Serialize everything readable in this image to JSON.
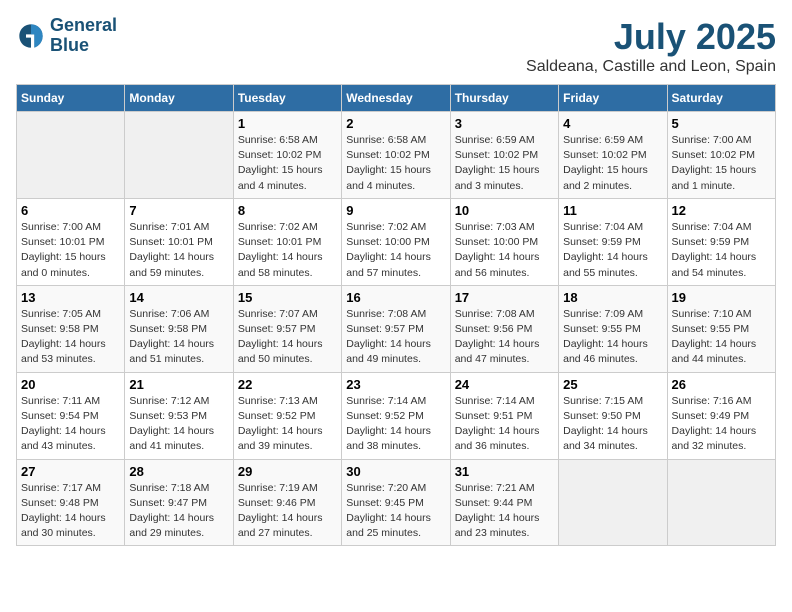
{
  "header": {
    "logo_line1": "General",
    "logo_line2": "Blue",
    "month_title": "July 2025",
    "location": "Saldeana, Castille and Leon, Spain"
  },
  "weekdays": [
    "Sunday",
    "Monday",
    "Tuesday",
    "Wednesday",
    "Thursday",
    "Friday",
    "Saturday"
  ],
  "weeks": [
    [
      {
        "day": "",
        "sunrise": "",
        "sunset": "",
        "daylight": ""
      },
      {
        "day": "",
        "sunrise": "",
        "sunset": "",
        "daylight": ""
      },
      {
        "day": "1",
        "sunrise": "Sunrise: 6:58 AM",
        "sunset": "Sunset: 10:02 PM",
        "daylight": "Daylight: 15 hours and 4 minutes."
      },
      {
        "day": "2",
        "sunrise": "Sunrise: 6:58 AM",
        "sunset": "Sunset: 10:02 PM",
        "daylight": "Daylight: 15 hours and 4 minutes."
      },
      {
        "day": "3",
        "sunrise": "Sunrise: 6:59 AM",
        "sunset": "Sunset: 10:02 PM",
        "daylight": "Daylight: 15 hours and 3 minutes."
      },
      {
        "day": "4",
        "sunrise": "Sunrise: 6:59 AM",
        "sunset": "Sunset: 10:02 PM",
        "daylight": "Daylight: 15 hours and 2 minutes."
      },
      {
        "day": "5",
        "sunrise": "Sunrise: 7:00 AM",
        "sunset": "Sunset: 10:02 PM",
        "daylight": "Daylight: 15 hours and 1 minute."
      }
    ],
    [
      {
        "day": "6",
        "sunrise": "Sunrise: 7:00 AM",
        "sunset": "Sunset: 10:01 PM",
        "daylight": "Daylight: 15 hours and 0 minutes."
      },
      {
        "day": "7",
        "sunrise": "Sunrise: 7:01 AM",
        "sunset": "Sunset: 10:01 PM",
        "daylight": "Daylight: 14 hours and 59 minutes."
      },
      {
        "day": "8",
        "sunrise": "Sunrise: 7:02 AM",
        "sunset": "Sunset: 10:01 PM",
        "daylight": "Daylight: 14 hours and 58 minutes."
      },
      {
        "day": "9",
        "sunrise": "Sunrise: 7:02 AM",
        "sunset": "Sunset: 10:00 PM",
        "daylight": "Daylight: 14 hours and 57 minutes."
      },
      {
        "day": "10",
        "sunrise": "Sunrise: 7:03 AM",
        "sunset": "Sunset: 10:00 PM",
        "daylight": "Daylight: 14 hours and 56 minutes."
      },
      {
        "day": "11",
        "sunrise": "Sunrise: 7:04 AM",
        "sunset": "Sunset: 9:59 PM",
        "daylight": "Daylight: 14 hours and 55 minutes."
      },
      {
        "day": "12",
        "sunrise": "Sunrise: 7:04 AM",
        "sunset": "Sunset: 9:59 PM",
        "daylight": "Daylight: 14 hours and 54 minutes."
      }
    ],
    [
      {
        "day": "13",
        "sunrise": "Sunrise: 7:05 AM",
        "sunset": "Sunset: 9:58 PM",
        "daylight": "Daylight: 14 hours and 53 minutes."
      },
      {
        "day": "14",
        "sunrise": "Sunrise: 7:06 AM",
        "sunset": "Sunset: 9:58 PM",
        "daylight": "Daylight: 14 hours and 51 minutes."
      },
      {
        "day": "15",
        "sunrise": "Sunrise: 7:07 AM",
        "sunset": "Sunset: 9:57 PM",
        "daylight": "Daylight: 14 hours and 50 minutes."
      },
      {
        "day": "16",
        "sunrise": "Sunrise: 7:08 AM",
        "sunset": "Sunset: 9:57 PM",
        "daylight": "Daylight: 14 hours and 49 minutes."
      },
      {
        "day": "17",
        "sunrise": "Sunrise: 7:08 AM",
        "sunset": "Sunset: 9:56 PM",
        "daylight": "Daylight: 14 hours and 47 minutes."
      },
      {
        "day": "18",
        "sunrise": "Sunrise: 7:09 AM",
        "sunset": "Sunset: 9:55 PM",
        "daylight": "Daylight: 14 hours and 46 minutes."
      },
      {
        "day": "19",
        "sunrise": "Sunrise: 7:10 AM",
        "sunset": "Sunset: 9:55 PM",
        "daylight": "Daylight: 14 hours and 44 minutes."
      }
    ],
    [
      {
        "day": "20",
        "sunrise": "Sunrise: 7:11 AM",
        "sunset": "Sunset: 9:54 PM",
        "daylight": "Daylight: 14 hours and 43 minutes."
      },
      {
        "day": "21",
        "sunrise": "Sunrise: 7:12 AM",
        "sunset": "Sunset: 9:53 PM",
        "daylight": "Daylight: 14 hours and 41 minutes."
      },
      {
        "day": "22",
        "sunrise": "Sunrise: 7:13 AM",
        "sunset": "Sunset: 9:52 PM",
        "daylight": "Daylight: 14 hours and 39 minutes."
      },
      {
        "day": "23",
        "sunrise": "Sunrise: 7:14 AM",
        "sunset": "Sunset: 9:52 PM",
        "daylight": "Daylight: 14 hours and 38 minutes."
      },
      {
        "day": "24",
        "sunrise": "Sunrise: 7:14 AM",
        "sunset": "Sunset: 9:51 PM",
        "daylight": "Daylight: 14 hours and 36 minutes."
      },
      {
        "day": "25",
        "sunrise": "Sunrise: 7:15 AM",
        "sunset": "Sunset: 9:50 PM",
        "daylight": "Daylight: 14 hours and 34 minutes."
      },
      {
        "day": "26",
        "sunrise": "Sunrise: 7:16 AM",
        "sunset": "Sunset: 9:49 PM",
        "daylight": "Daylight: 14 hours and 32 minutes."
      }
    ],
    [
      {
        "day": "27",
        "sunrise": "Sunrise: 7:17 AM",
        "sunset": "Sunset: 9:48 PM",
        "daylight": "Daylight: 14 hours and 30 minutes."
      },
      {
        "day": "28",
        "sunrise": "Sunrise: 7:18 AM",
        "sunset": "Sunset: 9:47 PM",
        "daylight": "Daylight: 14 hours and 29 minutes."
      },
      {
        "day": "29",
        "sunrise": "Sunrise: 7:19 AM",
        "sunset": "Sunset: 9:46 PM",
        "daylight": "Daylight: 14 hours and 27 minutes."
      },
      {
        "day": "30",
        "sunrise": "Sunrise: 7:20 AM",
        "sunset": "Sunset: 9:45 PM",
        "daylight": "Daylight: 14 hours and 25 minutes."
      },
      {
        "day": "31",
        "sunrise": "Sunrise: 7:21 AM",
        "sunset": "Sunset: 9:44 PM",
        "daylight": "Daylight: 14 hours and 23 minutes."
      },
      {
        "day": "",
        "sunrise": "",
        "sunset": "",
        "daylight": ""
      },
      {
        "day": "",
        "sunrise": "",
        "sunset": "",
        "daylight": ""
      }
    ]
  ]
}
